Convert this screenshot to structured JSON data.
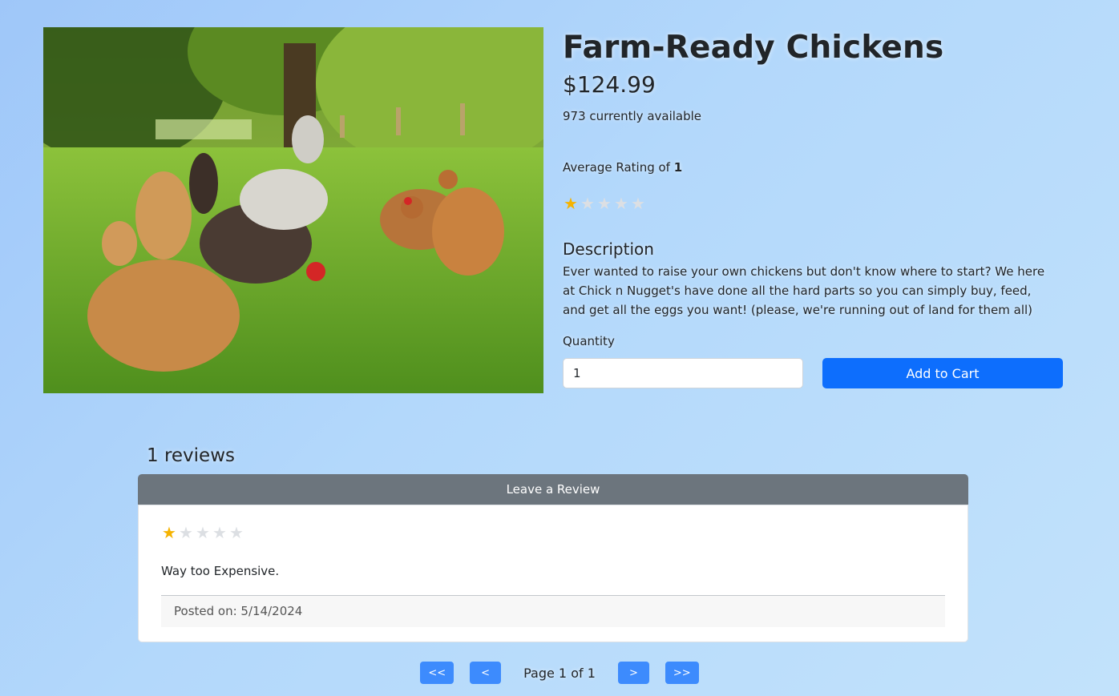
{
  "product": {
    "image_alt": "Chickens grazing on grass",
    "title": "Farm-Ready Chickens",
    "price": "$124.99",
    "availability": "973 currently available",
    "rating_label": "Average Rating of ",
    "rating_value": "1",
    "rating": 1,
    "rating_max": 5,
    "description_heading": "Description",
    "description": "Ever wanted to raise your own chickens but don't know where to start? We here at Chick n Nugget's have done all the hard parts so you can simply buy, feed, and get all the eggs you want! (please, we're running out of land for them all)",
    "quantity_label": "Quantity",
    "quantity_value": "1",
    "add_to_cart_label": "Add to Cart"
  },
  "reviews": {
    "count_label": "1 reviews",
    "leave_review_label": "Leave a Review",
    "items": [
      {
        "rating": 1,
        "text": "Way too Expensive.",
        "posted": "Posted on: 5/14/2024"
      }
    ]
  },
  "pagination": {
    "first_label": "<<",
    "prev_label": "<",
    "page_text": "Page 1 of 1",
    "next_label": ">",
    "last_label": ">>"
  },
  "colors": {
    "primary": "#0d6efd",
    "secondary": "#6c757d",
    "star_on": "#f5b301",
    "star_off": "#dcdfe3"
  }
}
